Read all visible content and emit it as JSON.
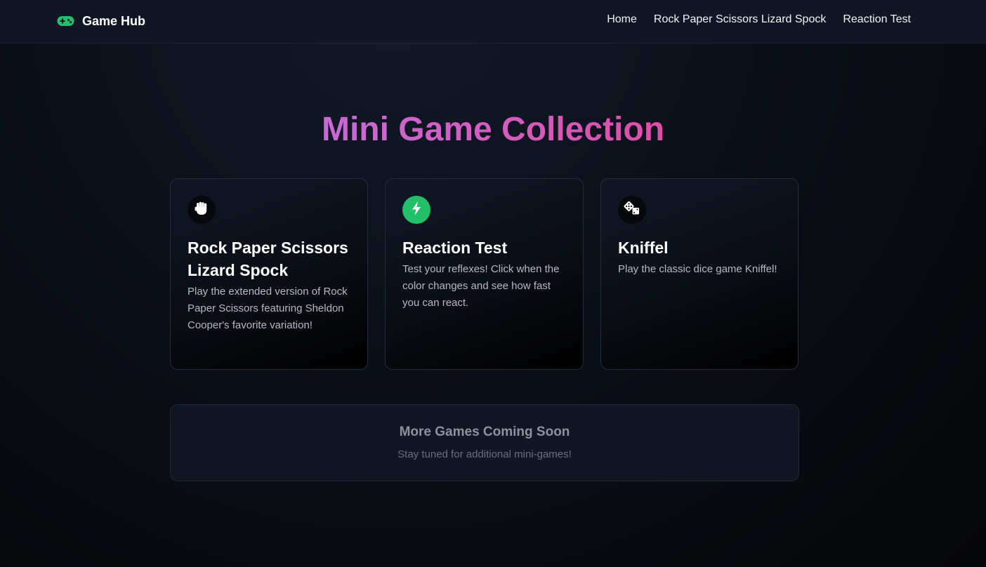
{
  "navbar": {
    "brand_icon": "gamepad-icon",
    "brand_title": "Game Hub",
    "brand_icon_color": "#22c06a",
    "links": [
      {
        "label": "Home"
      },
      {
        "label": "Rock Paper Scissors Lizard Spock"
      },
      {
        "label": "Reaction Test"
      }
    ]
  },
  "hero": {
    "title": "Mini Game Collection",
    "gradient_colors": [
      "#c86ad6",
      "#dd4fa8"
    ]
  },
  "cards": [
    {
      "icon": "hand-rock-icon",
      "title": "Rock Paper Scissors Lizard Spock",
      "description": "Play the extended version of Rock Paper Scissors featuring Sheldon Cooper's favorite variation!"
    },
    {
      "icon": "lightning-bolt-icon",
      "icon_color": "#22c06a",
      "title": "Reaction Test",
      "description": "Test your reflexes! Click when the color changes and see how fast you can react."
    },
    {
      "icon": "dice-icon",
      "title": "Kniffel",
      "description": "Play the classic dice game Kniffel!"
    }
  ],
  "coming_soon": {
    "title": "More Games Coming Soon",
    "subtitle": "Stay tuned for additional mini-games!"
  }
}
